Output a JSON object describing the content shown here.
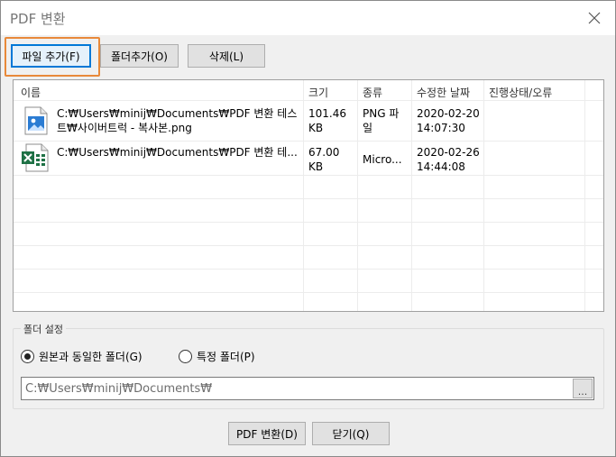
{
  "window": {
    "title": "PDF 변환"
  },
  "toolbar": {
    "add_file_label": "파일 추가(F)",
    "add_folder_label": "폴더추가(O)",
    "delete_label": "삭제(L)"
  },
  "list": {
    "columns": [
      "이름",
      "크기",
      "종류",
      "수정한 날짜",
      "진행상태/오류"
    ],
    "rows": [
      {
        "icon": "image-file-icon",
        "name_line1": "C:₩Users₩minij₩Documents₩PDF 변환 테스",
        "name_line2": "트₩사이버트럭 - 복사본.png",
        "size_line1": "101.46",
        "size_line2": "KB",
        "type_line1": "PNG 파",
        "type_line2": "일",
        "date_line1": "2020-02-20",
        "date_line2": "14:07:30",
        "status": ""
      },
      {
        "icon": "excel-file-icon",
        "name_line1": "C:₩Users₩minij₩Documents₩PDF 변환 테...",
        "name_line2": "",
        "size_line1": "67.00",
        "size_line2": "KB",
        "type_line1": "Micro...",
        "type_line2": "",
        "date_line1": "2020-02-26",
        "date_line2": "14:44:08",
        "status": ""
      }
    ]
  },
  "folder_settings": {
    "label": "폴더 설정",
    "option_same": "원본과 동일한 폴더(G)",
    "option_specific": "특정 폴더(P)",
    "selected": "same",
    "path": "C:₩Users₩minij₩Documents₩",
    "browse_label": "..."
  },
  "footer": {
    "convert_label": "PDF 변환(D)",
    "close_label": "닫기(Q)"
  },
  "colors": {
    "accent": "#0078d7",
    "focus_highlight": "#e8893a",
    "excel_green": "#1e7145",
    "image_blue": "#2b7cd3"
  }
}
